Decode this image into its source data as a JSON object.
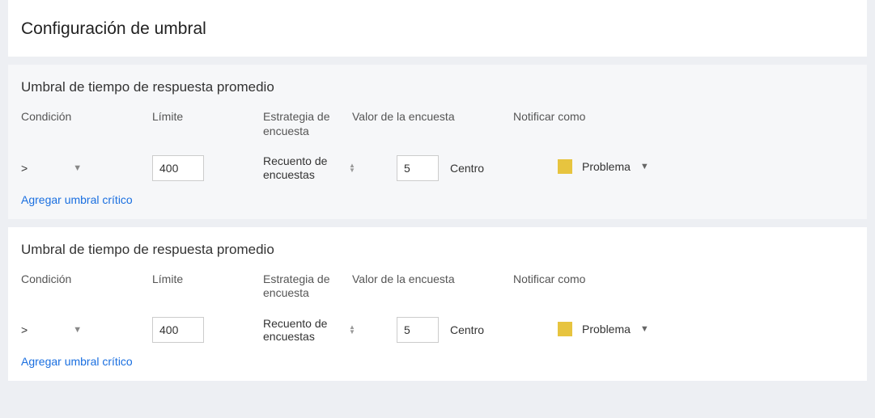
{
  "page_title": "Configuración de umbral",
  "headers": {
    "condition": "Condición",
    "limit": "Límite",
    "strategy": "Estrategia de encuesta",
    "poll_value": "Valor de la encuesta",
    "notify_as": "Notificar como"
  },
  "sections": [
    {
      "title": "Umbral de tiempo de respuesta promedio",
      "condition_value": ">",
      "limit_value": "400",
      "strategy_value": "Recuento de encuestas",
      "poll_value": "5",
      "poll_unit": "Centro",
      "notify_label": "Problema",
      "swatch_color": "#e7c43f",
      "add_link": "Agregar umbral crítico"
    },
    {
      "title": "Umbral de tiempo de respuesta promedio",
      "condition_value": ">",
      "limit_value": "400",
      "strategy_value": "Recuento de encuestas",
      "poll_value": "5",
      "poll_unit": "Centro",
      "notify_label": "Problema",
      "swatch_color": "#e7c43f",
      "add_link": "Agregar umbral crítico"
    }
  ]
}
